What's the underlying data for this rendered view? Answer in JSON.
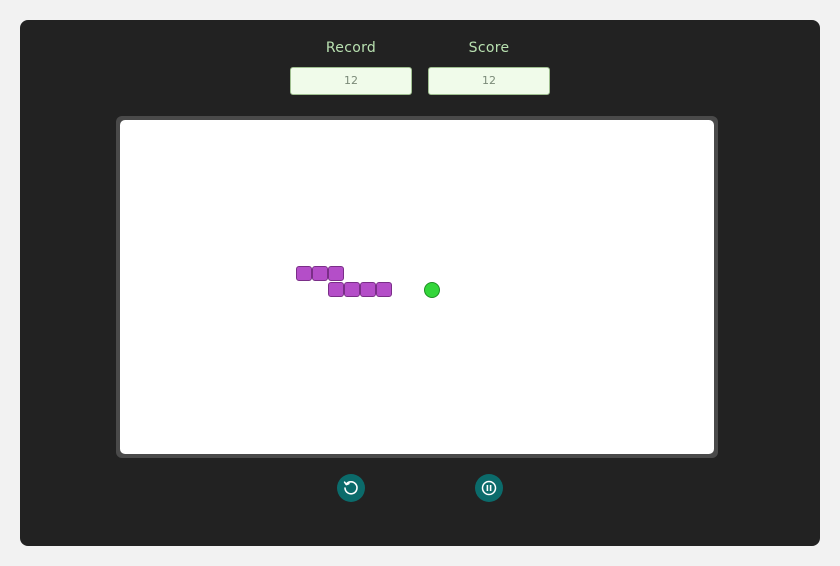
{
  "scoreboard": {
    "record_label": "Record",
    "record_value": "12",
    "score_label": "Score",
    "score_value": "12"
  },
  "game": {
    "snake_color": "#b44ec8",
    "food_color": "#33d63a",
    "snake_length": 7
  },
  "controls": {
    "restart_icon": "restart-icon",
    "pause_icon": "pause-icon",
    "accent_color": "#0b6b6b"
  }
}
